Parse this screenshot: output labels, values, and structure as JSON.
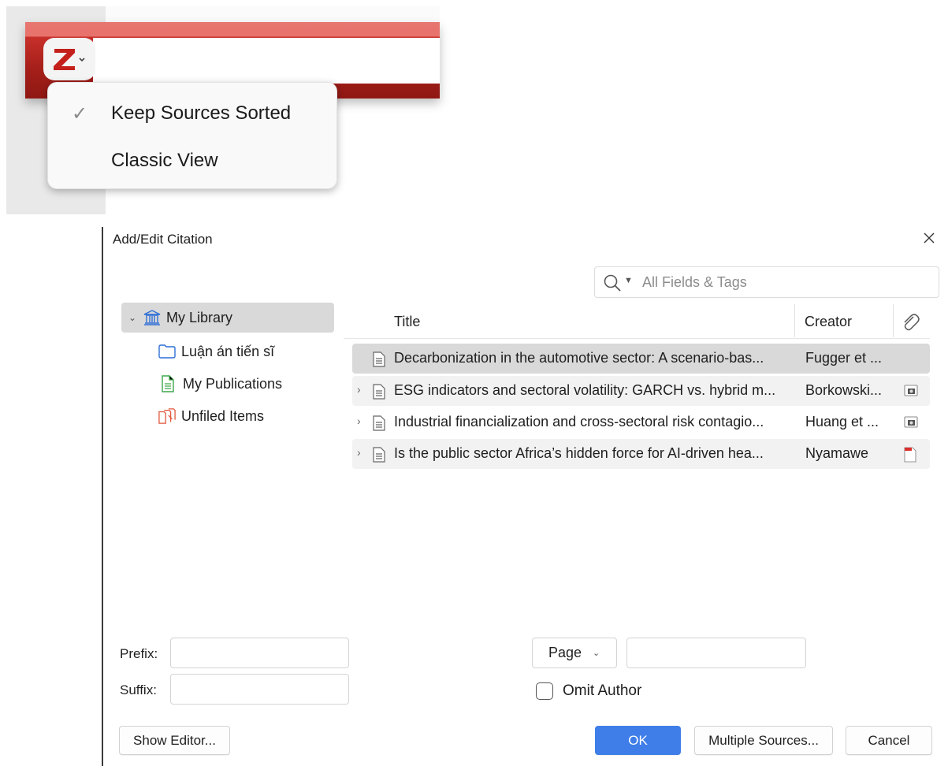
{
  "toolbar": {
    "zotero_button_icon": "zotero-z-logo-icon",
    "dropdown_icon": "chevron-down-icon",
    "accent_color": "#b0221c"
  },
  "menu": {
    "items": [
      {
        "label": "Keep Sources Sorted",
        "checked": true
      },
      {
        "label": "Classic View",
        "checked": false
      }
    ]
  },
  "dialog": {
    "title": "Add/Edit Citation",
    "close_icon": "close-icon",
    "search": {
      "placeholder": "All Fields & Tags",
      "value": ""
    },
    "collections": [
      {
        "label": "My Library",
        "icon": "library-icon",
        "expanded": true,
        "selected": true
      },
      {
        "label": "Luận án tiến sĩ",
        "icon": "folder-icon"
      },
      {
        "label": "My Publications",
        "icon": "publications-icon"
      },
      {
        "label": "Unfiled Items",
        "icon": "unfiled-icon"
      }
    ],
    "columns": {
      "title": "Title",
      "creator": "Creator",
      "attachment_icon": "paperclip-icon"
    },
    "items": [
      {
        "title": "Decarbonization in the automotive sector: A scenario-bas...",
        "creator": "Fugger et ...",
        "has_children": false,
        "attachment": "none",
        "selected": true
      },
      {
        "title": "ESG indicators and sectoral volatility: GARCH vs. hybrid m...",
        "creator": "Borkowski...",
        "has_children": true,
        "attachment": "snapshot"
      },
      {
        "title": "Industrial financialization and cross-sectoral risk contagio...",
        "creator": "Huang et ...",
        "has_children": true,
        "attachment": "snapshot"
      },
      {
        "title": "Is the public sector Africa’s hidden force for AI-driven hea...",
        "creator": "Nyamawe",
        "has_children": true,
        "attachment": "pdf"
      }
    ],
    "prefix_label": "Prefix:",
    "suffix_label": "Suffix:",
    "prefix_value": "",
    "suffix_value": "",
    "locator_label": "Page",
    "locator_value": "",
    "omit_author_label": "Omit Author",
    "omit_author_checked": false,
    "buttons": {
      "show_editor": "Show Editor...",
      "ok": "OK",
      "multiple_sources": "Multiple Sources...",
      "cancel": "Cancel"
    },
    "primary_color": "#3f7ee8"
  }
}
